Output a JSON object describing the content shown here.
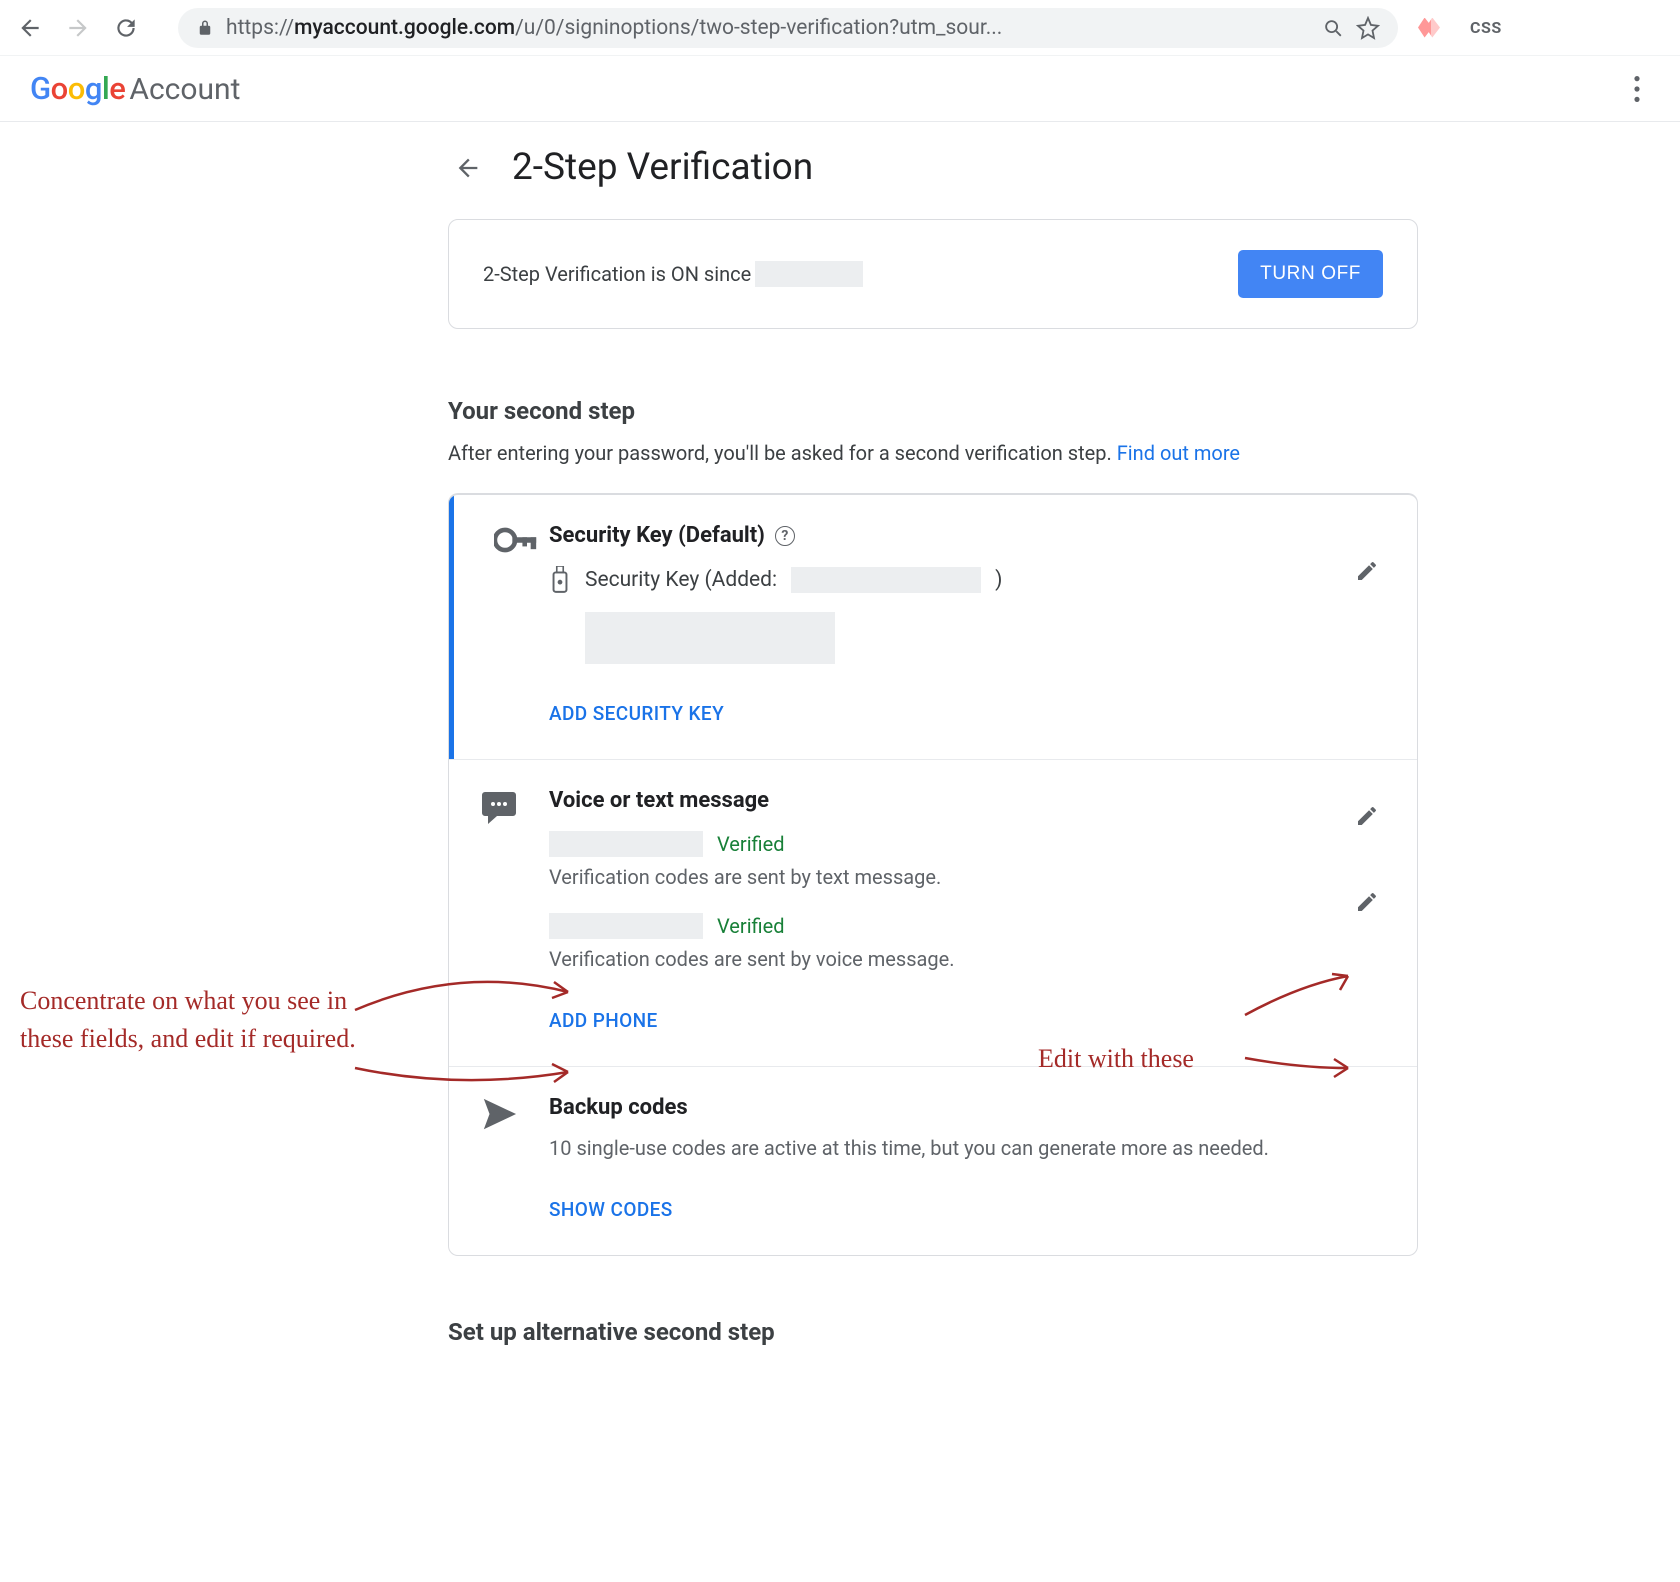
{
  "browser": {
    "url_display_proto": "https://",
    "url_display_host": "myaccount.google.com",
    "url_display_path": "/u/0/signinoptions/two-step-verification?utm_sour...",
    "ext_label": "CSS"
  },
  "header": {
    "logo_google": "Google",
    "logo_account": "Account"
  },
  "page": {
    "title": "2-Step Verification"
  },
  "status": {
    "text": "2-Step Verification is ON since",
    "redacted_value": "",
    "turn_off": "TURN OFF"
  },
  "second_step": {
    "heading": "Your second step",
    "sub": "After entering your password, you'll be asked for a second verification step. ",
    "link": "Find out more"
  },
  "methods": {
    "security_key": {
      "title": "Security Key",
      "default": " (Default)",
      "row_prefix": "Security Key (Added: ",
      "row_suffix": ")",
      "action": "ADD SECURITY KEY"
    },
    "voice_text": {
      "title": "Voice or text message",
      "entries": [
        {
          "verified": "Verified",
          "desc": "Verification codes are sent by text message."
        },
        {
          "verified": "Verified",
          "desc": "Verification codes are sent by voice message."
        }
      ],
      "action": "ADD PHONE"
    },
    "backup": {
      "title": "Backup codes",
      "desc": "10 single-use codes are active at this time, but you can generate more as needed.",
      "action": "SHOW CODES"
    }
  },
  "alternative": {
    "heading": "Set up alternative second step"
  },
  "annotations": {
    "left": "Concentrate on what you see in these fields, and edit if required.",
    "right": "Edit with these"
  }
}
